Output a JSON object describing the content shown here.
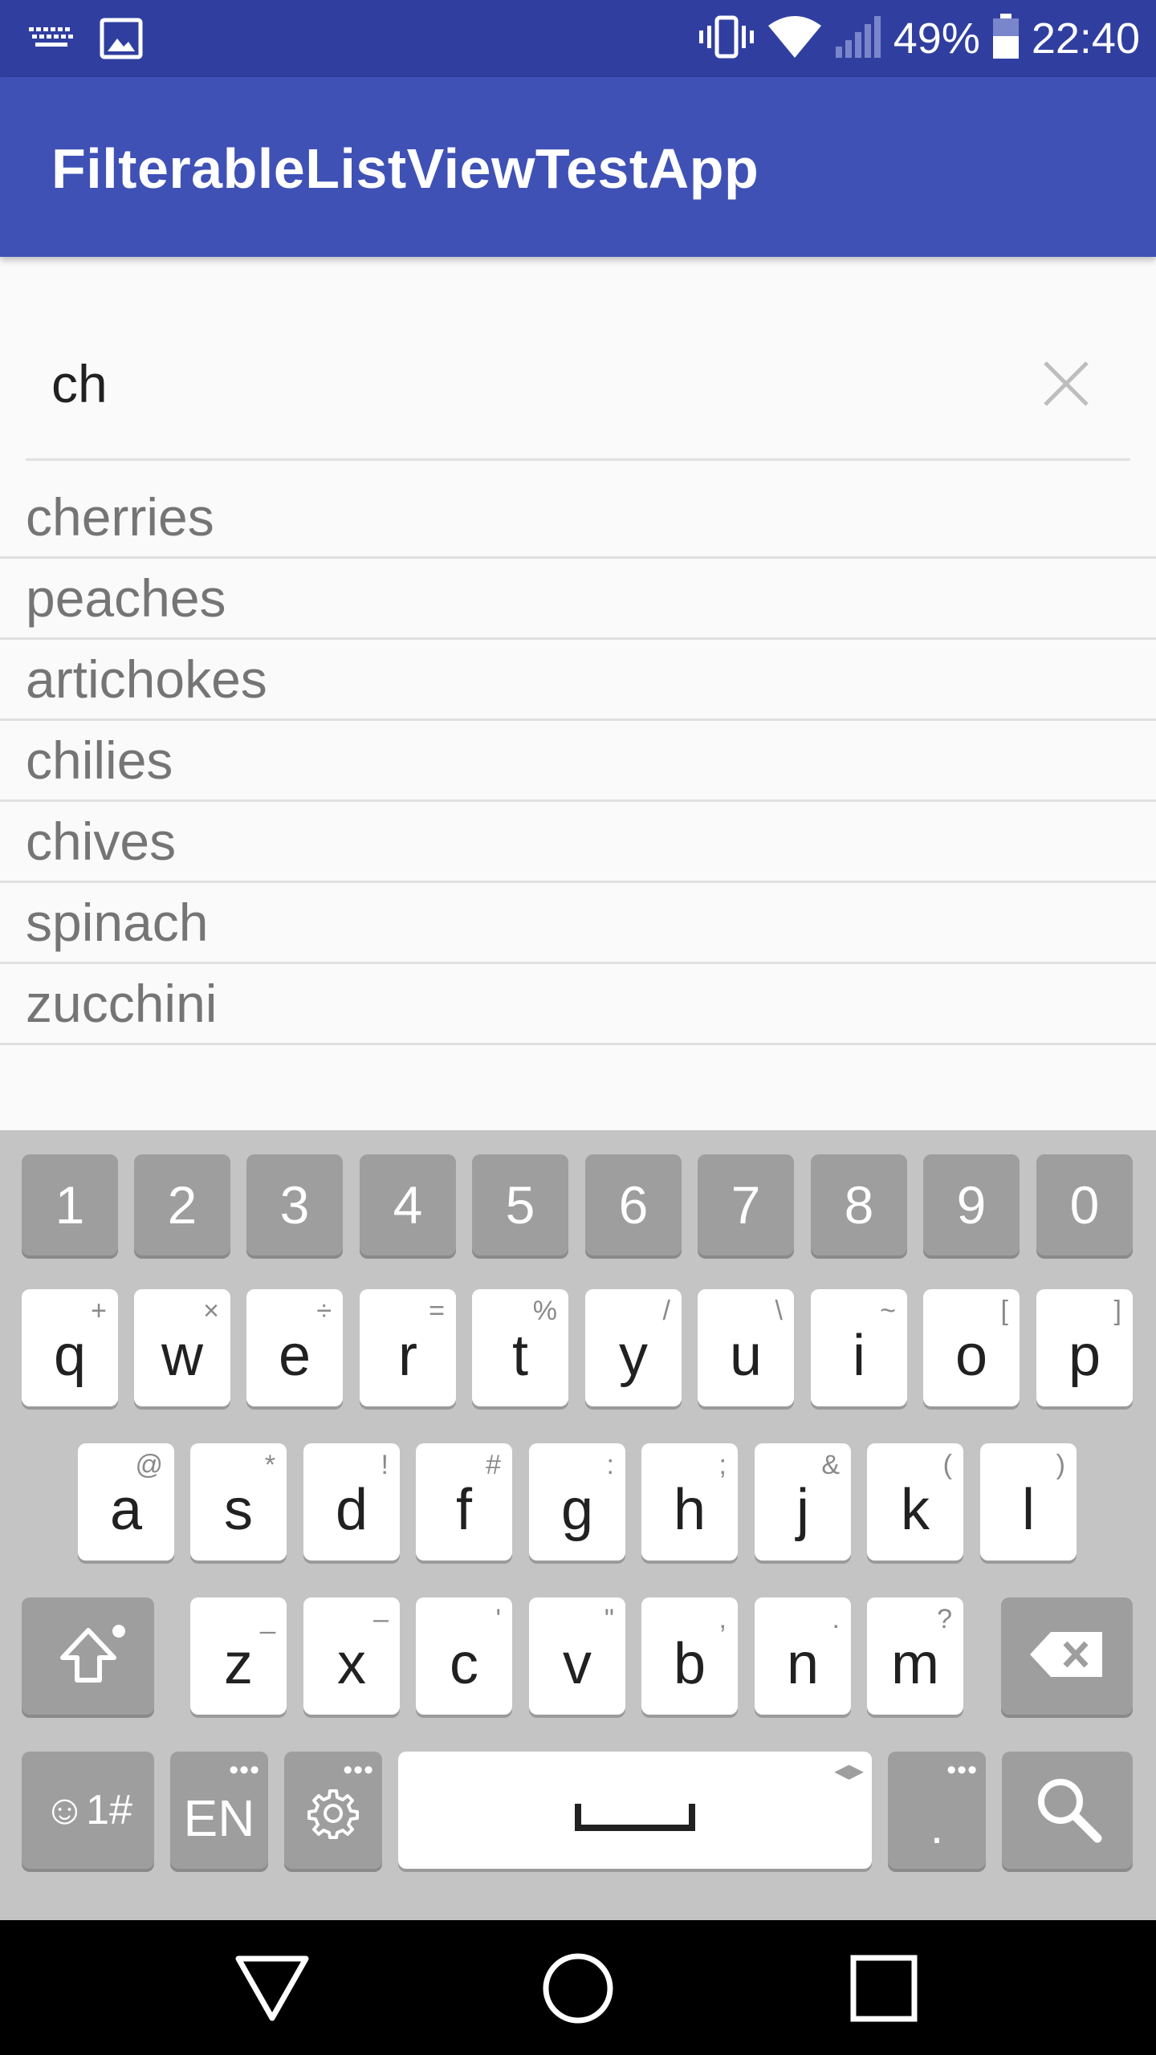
{
  "status_bar": {
    "battery_percent": "49%",
    "time": "22:40",
    "left_icons": [
      "keyboard-icon",
      "image-icon"
    ],
    "right_icons": [
      "vibrate-icon",
      "wifi-icon",
      "signal-icon",
      "battery-icon"
    ]
  },
  "app_bar": {
    "title": "FilterableListViewTestApp",
    "color": "#3f51b5",
    "status_color": "#303f9f"
  },
  "search": {
    "value": "ch",
    "clear_icon": "close-icon"
  },
  "list": {
    "items": [
      "cherries",
      "peaches",
      "artichokes",
      "chilies",
      "chives",
      "spinach",
      "zucchini"
    ]
  },
  "keyboard": {
    "number_row": [
      "1",
      "2",
      "3",
      "4",
      "5",
      "6",
      "7",
      "8",
      "9",
      "0"
    ],
    "row1": [
      {
        "key": "q",
        "hint": "+"
      },
      {
        "key": "w",
        "hint": "×"
      },
      {
        "key": "e",
        "hint": "÷"
      },
      {
        "key": "r",
        "hint": "="
      },
      {
        "key": "t",
        "hint": "%"
      },
      {
        "key": "y",
        "hint": "/"
      },
      {
        "key": "u",
        "hint": "\\"
      },
      {
        "key": "i",
        "hint": "~"
      },
      {
        "key": "o",
        "hint": "["
      },
      {
        "key": "p",
        "hint": "]"
      }
    ],
    "row2": [
      {
        "key": "a",
        "hint": "@"
      },
      {
        "key": "s",
        "hint": "*"
      },
      {
        "key": "d",
        "hint": "!"
      },
      {
        "key": "f",
        "hint": "#"
      },
      {
        "key": "g",
        "hint": ":"
      },
      {
        "key": "h",
        "hint": ";"
      },
      {
        "key": "j",
        "hint": "&"
      },
      {
        "key": "k",
        "hint": "("
      },
      {
        "key": "l",
        "hint": ")"
      }
    ],
    "row3": [
      {
        "key": "z",
        "hint": "_"
      },
      {
        "key": "x",
        "hint": "–"
      },
      {
        "key": "c",
        "hint": "'"
      },
      {
        "key": "v",
        "hint": "\""
      },
      {
        "key": "b",
        "hint": ","
      },
      {
        "key": "n",
        "hint": "."
      },
      {
        "key": "m",
        "hint": "?"
      }
    ],
    "symbols_label": "☺1#",
    "language_label": "EN",
    "period_label": ".",
    "icons": [
      "shift-icon",
      "backspace-icon",
      "settings-icon",
      "space-icon",
      "search-icon"
    ]
  },
  "nav_bar": {
    "icons": [
      "back-icon",
      "home-icon",
      "recents-icon"
    ]
  }
}
